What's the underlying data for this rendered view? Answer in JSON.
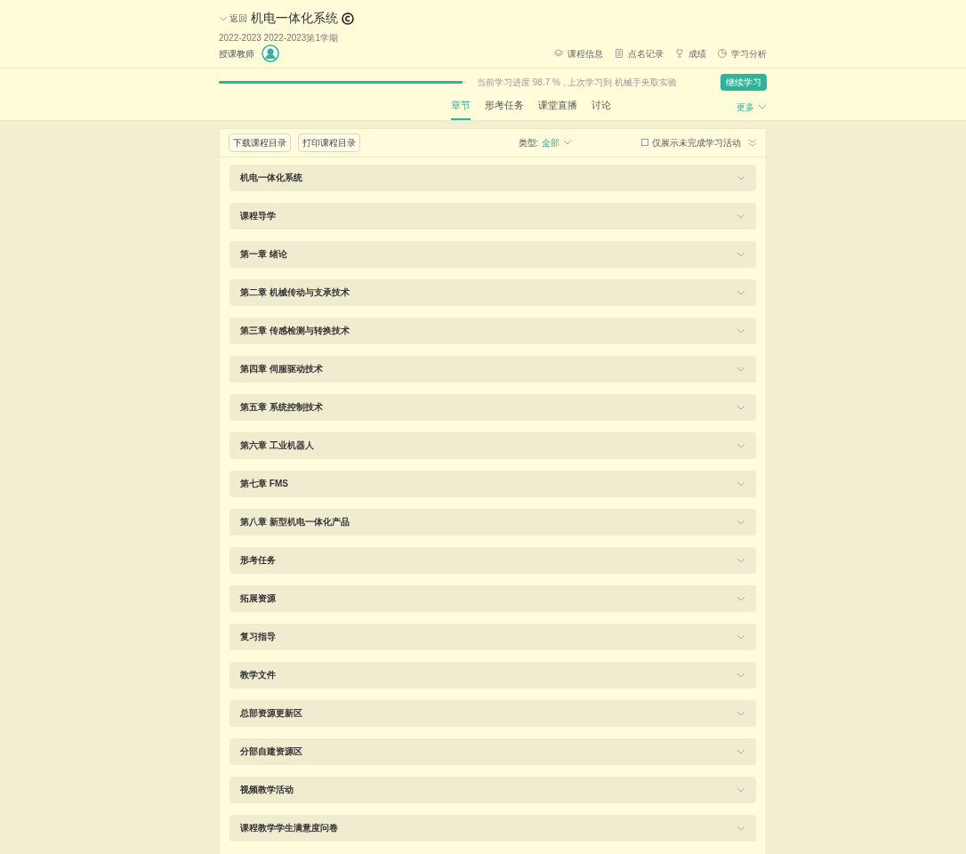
{
  "header": {
    "back": "返回",
    "title": "机电一体化系统",
    "term": "2022-2023 2022-2023第1学期",
    "teacher_label": "授课教师",
    "links": [
      {
        "kind": "layers",
        "label": "课程信息"
      },
      {
        "kind": "doc",
        "label": "点名记录"
      },
      {
        "kind": "trophy",
        "label": "成绩"
      },
      {
        "kind": "pie",
        "label": "学习分析"
      }
    ]
  },
  "progress": {
    "level": 0.987,
    "text": "当前学习进度 98.7 % , 上次学习到 机械手夹取实验",
    "continue": "继续学习"
  },
  "tabs": [
    {
      "label": "章节",
      "selected": true
    },
    {
      "label": "形考任务",
      "selected": false
    },
    {
      "label": "课堂直播",
      "selected": false
    },
    {
      "label": "讨论",
      "selected": false
    }
  ],
  "more": "更多",
  "toolbar": {
    "buttons": [
      "下载课程目录",
      "打印课程目录"
    ],
    "type_label": "类型:",
    "type_value": "全部",
    "filter": {
      "label": "仅展示未完成学习活动",
      "checked": false
    }
  },
  "chapters": [
    {
      "title": "机电一体化系统",
      "expanded": false
    },
    {
      "title": "课程导学",
      "expanded": false
    },
    {
      "title": "第一章 绪论",
      "expanded": false
    },
    {
      "title": "第二章 机械传动与支承技术",
      "expanded": false
    },
    {
      "title": "第三章 传感检测与转换技术",
      "expanded": false
    },
    {
      "title": "第四章 伺服驱动技术",
      "expanded": false
    },
    {
      "title": "第五章 系统控制技术",
      "expanded": false
    },
    {
      "title": "第六章 工业机器人",
      "expanded": false
    },
    {
      "title": "第七章 FMS",
      "expanded": false
    },
    {
      "title": "第八章 新型机电一体化产品",
      "expanded": false
    },
    {
      "title": "形考任务",
      "expanded": false
    },
    {
      "title": "拓展资源",
      "expanded": false
    },
    {
      "title": "复习指导",
      "expanded": false
    },
    {
      "title": "教学文件",
      "expanded": false
    },
    {
      "title": "总部资源更新区",
      "expanded": false
    },
    {
      "title": "分部自建资源区",
      "expanded": false
    },
    {
      "title": "视频教学活动",
      "expanded": false
    },
    {
      "title": "课程教学学生满意度问卷",
      "expanded": false
    }
  ]
}
